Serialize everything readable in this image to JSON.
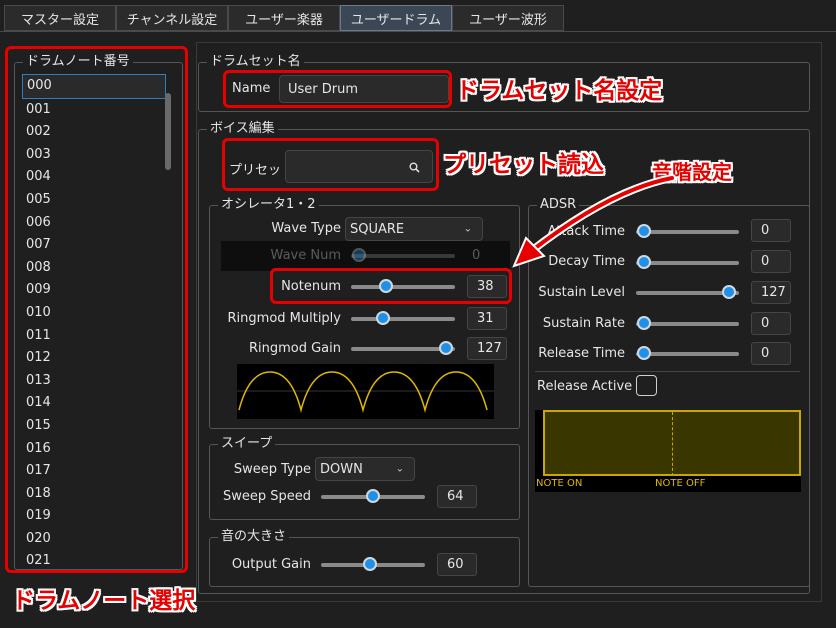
{
  "tabs": [
    "マスター設定",
    "チャンネル設定",
    "ユーザー楽器",
    "ユーザードラム",
    "ユーザー波形"
  ],
  "active_tab": "ユーザードラム",
  "drum_list": {
    "title": "ドラムノート番号",
    "items": [
      "000",
      "001",
      "002",
      "003",
      "004",
      "005",
      "006",
      "007",
      "008",
      "009",
      "010",
      "011",
      "012",
      "013",
      "014",
      "015",
      "016",
      "017",
      "018",
      "019",
      "020",
      "021"
    ],
    "selected": "000"
  },
  "drumset": {
    "title": "ドラムセット名",
    "name_label": "Name",
    "name_value": "User Drum"
  },
  "voice": {
    "title": "ボイス編集",
    "preset_label": "プリセット",
    "preset_value": "",
    "search_icon": "search-icon"
  },
  "oscillator": {
    "title": "オシレータ1・2",
    "wave_type_label": "Wave Type",
    "wave_type_value": "SQUARE",
    "wave_num_label": "Wave Num",
    "wave_num_value": "0",
    "notenum_label": "Notenum",
    "notenum_value": "38",
    "ringmod_multiply_label": "Ringmod Multiply",
    "ringmod_multiply_value": "31",
    "ringmod_gain_label": "Ringmod Gain",
    "ringmod_gain_value": "127"
  },
  "sweep": {
    "title": "スイープ",
    "type_label": "Sweep Type",
    "type_value": "DOWN",
    "speed_label": "Sweep Speed",
    "speed_value": "64"
  },
  "volume": {
    "title": "音の大きさ",
    "gain_label": "Output Gain",
    "gain_value": "60"
  },
  "adsr": {
    "title": "ADSR",
    "attack_label": "Attack Time",
    "attack_value": "0",
    "decay_label": "Decay Time",
    "decay_value": "0",
    "sustain_level_label": "Sustain Level",
    "sustain_level_value": "127",
    "sustain_rate_label": "Sustain Rate",
    "sustain_rate_value": "0",
    "release_label": "Release Time",
    "release_value": "0",
    "release_active_label": "Release Active",
    "note_on_label": "NOTE ON",
    "note_off_label": "NOTE OFF"
  },
  "annotations": {
    "drumset_name": "ドラムセット名設定",
    "preset_load": "プリセット読込",
    "pitch": "音階設定",
    "drum_note": "ドラムノート選択"
  },
  "colors": {
    "accent": "#1e90e8",
    "annotation": "#e60000",
    "wave": "#e0b800",
    "env_border": "#c8a800"
  }
}
